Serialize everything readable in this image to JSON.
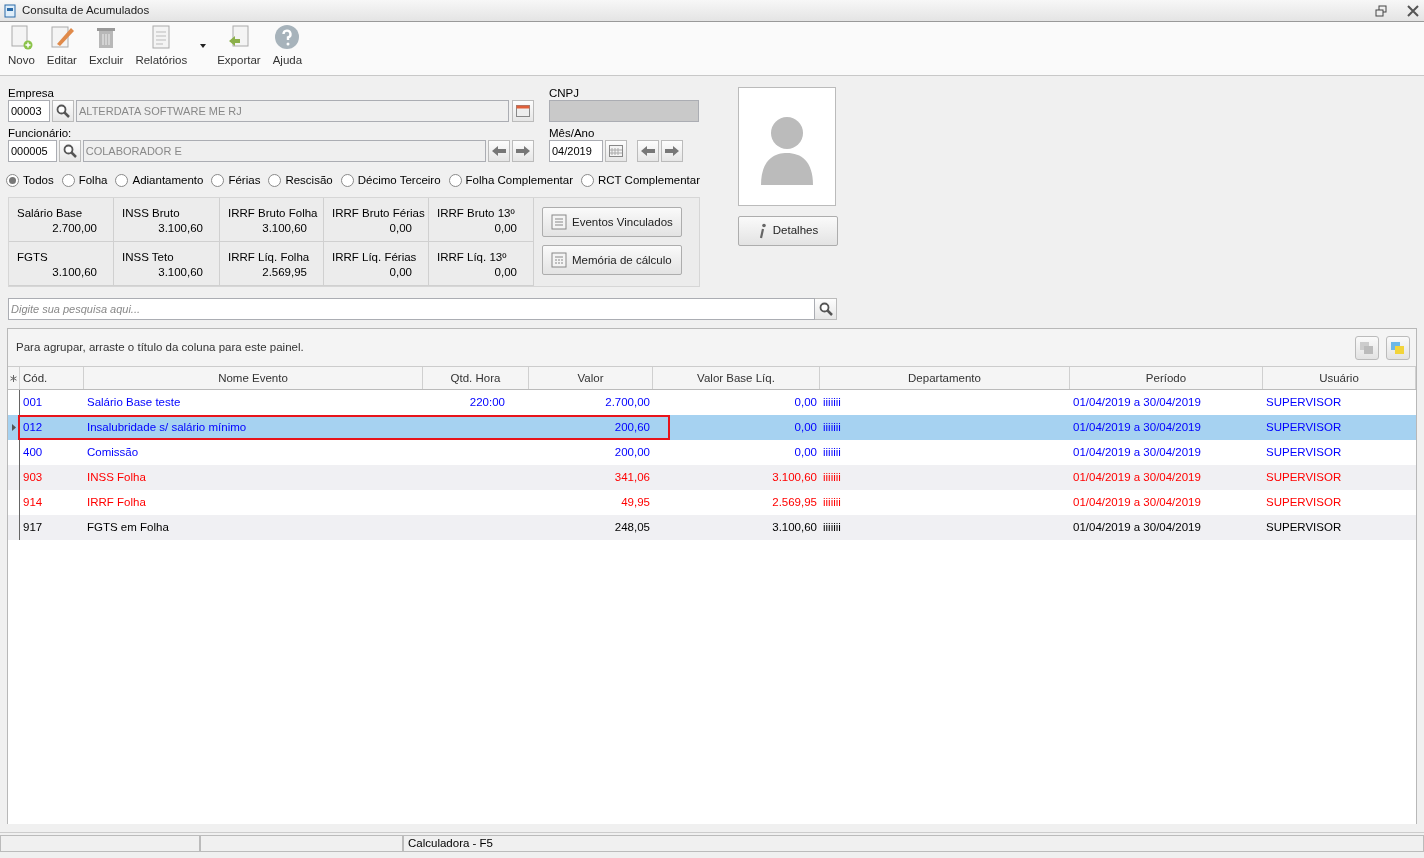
{
  "window": {
    "title": "Consulta de Acumulados"
  },
  "toolbar": [
    {
      "label": "Novo",
      "kind": "new",
      "dropdown": false
    },
    {
      "label": "Editar",
      "kind": "edit",
      "dropdown": false
    },
    {
      "label": "Excluir",
      "kind": "delete",
      "dropdown": false
    },
    {
      "label": "Relatórios",
      "kind": "report",
      "dropdown": true
    },
    {
      "label": "Exportar",
      "kind": "export",
      "dropdown": false
    },
    {
      "label": "Ajuda",
      "kind": "help",
      "dropdown": false
    }
  ],
  "empresa": {
    "label": "Empresa",
    "code": "00003",
    "name": "ALTERDATA SOFTWARE ME RJ"
  },
  "cnpj": {
    "label": "CNPJ"
  },
  "funcionario": {
    "label": "Funcionário:",
    "code": "000005",
    "name": "COLABORADOR E"
  },
  "mes_ano": {
    "label": "Mês/Ano",
    "value": "04/2019"
  },
  "filters": [
    {
      "label": "Todos",
      "selected": true
    },
    {
      "label": "Folha",
      "selected": false
    },
    {
      "label": "Adiantamento",
      "selected": false
    },
    {
      "label": "Férias",
      "selected": false
    },
    {
      "label": "Rescisão",
      "selected": false
    },
    {
      "label": "Décimo Terceiro",
      "selected": false
    },
    {
      "label": "Folha Complementar",
      "selected": false
    },
    {
      "label": "RCT Complementar",
      "selected": false
    }
  ],
  "summary": [
    {
      "label": "Salário Base",
      "value": "2.700,00"
    },
    {
      "label": "INSS Bruto",
      "value": "3.100,60"
    },
    {
      "label": "IRRF Bruto Folha",
      "value": "3.100,60"
    },
    {
      "label": "IRRF Bruto Férias",
      "value": "0,00"
    },
    {
      "label": "IRRF Bruto 13º",
      "value": "0,00"
    },
    {
      "label": "FGTS",
      "value": "3.100,60"
    },
    {
      "label": "INSS Teto",
      "value": "3.100,60"
    },
    {
      "label": "IRRF Líq. Folha",
      "value": "2.569,95"
    },
    {
      "label": "IRRF Líq. Férias",
      "value": "0,00"
    },
    {
      "label": "IRRF Líq. 13º",
      "value": "0,00"
    }
  ],
  "side_buttons": [
    {
      "label": "Eventos Vinculados",
      "kind": "list"
    },
    {
      "label": "Memória de cálculo",
      "kind": "calc"
    }
  ],
  "details_button": {
    "label": "Detalhes"
  },
  "search": {
    "placeholder": "Digite sua pesquisa aqui..."
  },
  "group_panel": {
    "text": "Para agrupar, arraste o título da coluna para este painel."
  },
  "table": {
    "columns": [
      "Cód.",
      "Nome Evento",
      "Qtd. Hora",
      "Valor",
      "Valor Base Líq.",
      "Departamento",
      "Período",
      "Usuário"
    ],
    "rows": [
      {
        "cells": [
          "001",
          "Salário Base teste",
          "220:00",
          "2.700,00",
          "0,00",
          "iiiiiii",
          "01/04/2019 a 30/04/2019",
          "SUPERVISOR"
        ],
        "color": "#0000ff",
        "selected": false,
        "outlined": false
      },
      {
        "cells": [
          "012",
          "Insalubridade s/ salário mínimo",
          "",
          "200,60",
          "0,00",
          "iiiiiii",
          "01/04/2019 a 30/04/2019",
          "SUPERVISOR"
        ],
        "color": "#0000ff",
        "selected": true,
        "outlined": true
      },
      {
        "cells": [
          "400",
          "Comissão",
          "",
          "200,00",
          "0,00",
          "iiiiiii",
          "01/04/2019 a 30/04/2019",
          "SUPERVISOR"
        ],
        "color": "#0000ff",
        "selected": false,
        "outlined": false
      },
      {
        "cells": [
          "903",
          "INSS Folha",
          "",
          "341,06",
          "3.100,60",
          "iiiiiii",
          "01/04/2019 a 30/04/2019",
          "SUPERVISOR"
        ],
        "color": "#ff0000",
        "selected": false,
        "outlined": false
      },
      {
        "cells": [
          "914",
          "IRRF Folha",
          "",
          "49,95",
          "2.569,95",
          "iiiiiii",
          "01/04/2019 a 30/04/2019",
          "SUPERVISOR"
        ],
        "color": "#ff0000",
        "selected": false,
        "outlined": false
      },
      {
        "cells": [
          "917",
          "FGTS em Folha",
          "",
          "248,05",
          "3.100,60",
          "iiiiiii",
          "01/04/2019 a 30/04/2019",
          "SUPERVISOR"
        ],
        "color": "#000000",
        "selected": false,
        "outlined": false
      }
    ]
  },
  "status_bar": {
    "text": "Calculadora - F5"
  }
}
